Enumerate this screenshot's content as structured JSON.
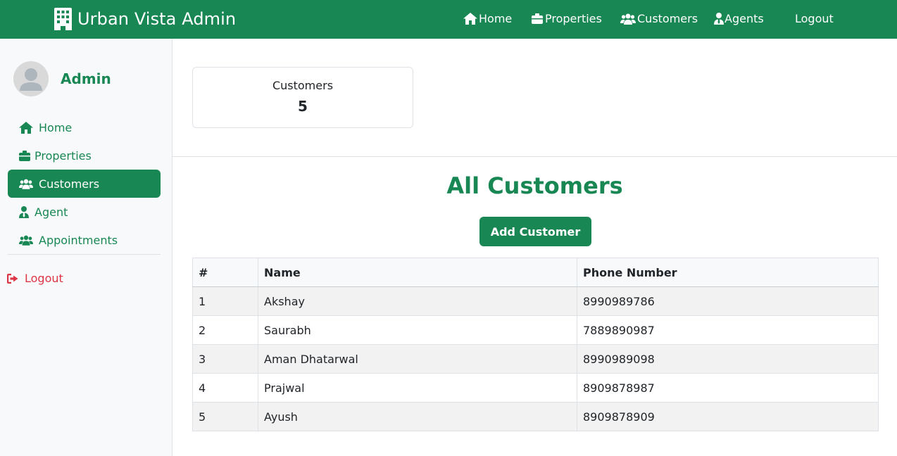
{
  "brand": {
    "title": "Urban Vista Admin"
  },
  "topnav": {
    "home": "Home",
    "properties": "Properties",
    "customers": "Customers",
    "agents": "Agents",
    "logout": "Logout"
  },
  "sidebar": {
    "user_name": "Admin",
    "items": [
      {
        "label": "Home",
        "icon": "home-icon",
        "active": false
      },
      {
        "label": "Properties",
        "icon": "building-icon",
        "active": false
      },
      {
        "label": "Customers",
        "icon": "users-icon",
        "active": true
      },
      {
        "label": "Agent",
        "icon": "user-tie-icon",
        "active": false
      },
      {
        "label": "Appointments",
        "icon": "users-icon",
        "active": false
      }
    ],
    "logout": "Logout"
  },
  "stats": {
    "label": "Customers",
    "value": "5"
  },
  "page": {
    "title": "All Customers",
    "add_button": "Add Customer"
  },
  "table": {
    "headers": [
      "#",
      "Name",
      "Phone Number"
    ],
    "rows": [
      [
        "1",
        "Akshay",
        "8990989786"
      ],
      [
        "2",
        "Saurabh",
        "7889890987"
      ],
      [
        "3",
        "Aman Dhatarwal",
        "8990989098"
      ],
      [
        "4",
        "Prajwal",
        "8909878987"
      ],
      [
        "5",
        "Ayush",
        "8909878909"
      ]
    ]
  },
  "colors": {
    "primary": "#198754",
    "danger": "#dc3545",
    "sidebar_bg": "#f8f9fa"
  }
}
